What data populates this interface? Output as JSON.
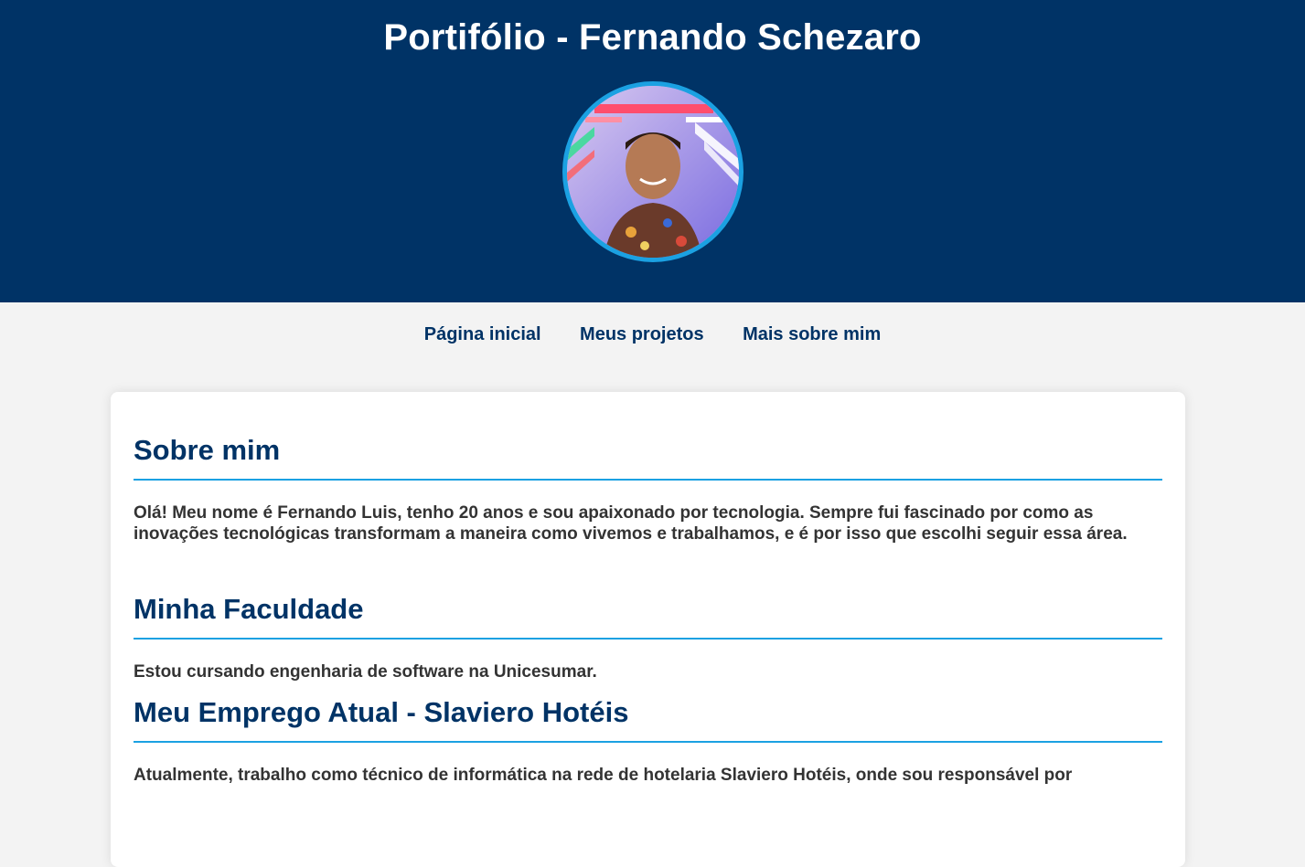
{
  "header": {
    "title": "Portifólio - Fernando Schezaro",
    "avatar_icon": "profile-photo"
  },
  "nav": {
    "items": [
      "Página inicial",
      "Meus projetos",
      "Mais sobre mim"
    ]
  },
  "sections": [
    {
      "title": "Sobre mim",
      "text": "Olá! Meu nome é Fernando Luis, tenho 20 anos e sou apaixonado por tecnologia. Sempre fui fascinado por como as inovações tecnológicas transformam a maneira como vivemos e trabalhamos, e é por isso que escolhi seguir essa área."
    },
    {
      "title": "Minha Faculdade",
      "text": "Estou cursando engenharia de software na Unicesumar."
    },
    {
      "title": "Meu Emprego Atual - Slaviero Hotéis",
      "text": "Atualmente, trabalho como técnico de informática na rede de hotelaria Slaviero Hotéis, onde sou responsável por"
    }
  ],
  "colors": {
    "header_bg": "#003366",
    "accent": "#1ba1e2",
    "page_bg": "#f3f3f3"
  }
}
